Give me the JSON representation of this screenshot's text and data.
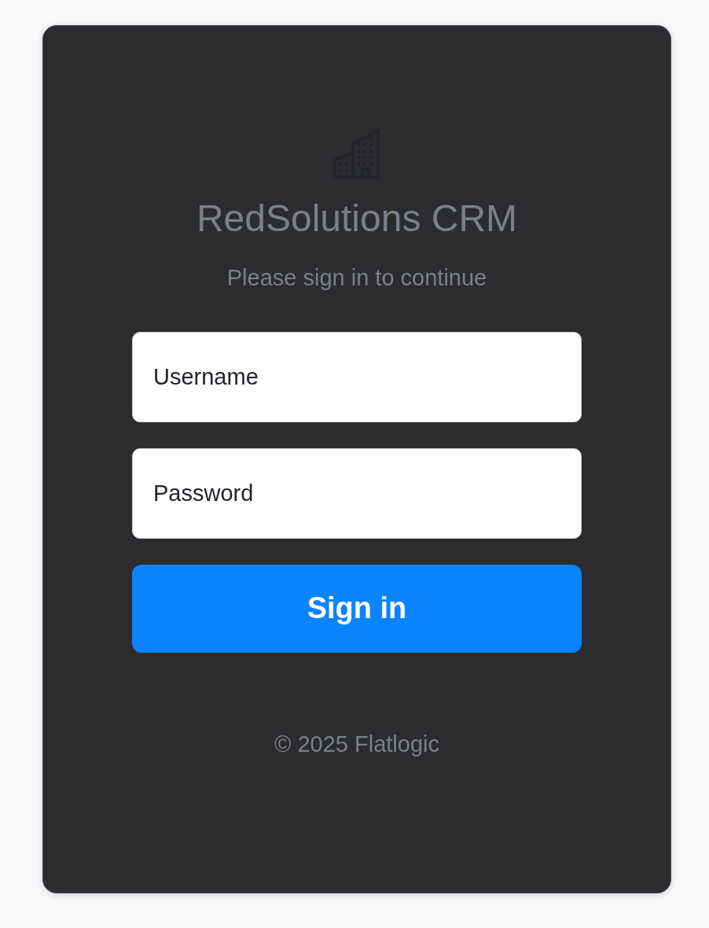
{
  "login": {
    "title": "RedSolutions CRM",
    "subtitle": "Please sign in to continue",
    "fields": [
      {
        "placeholder": "Username"
      },
      {
        "placeholder": "Password"
      }
    ],
    "button": "Sign in",
    "footer": "© 2025 Flatlogic"
  }
}
